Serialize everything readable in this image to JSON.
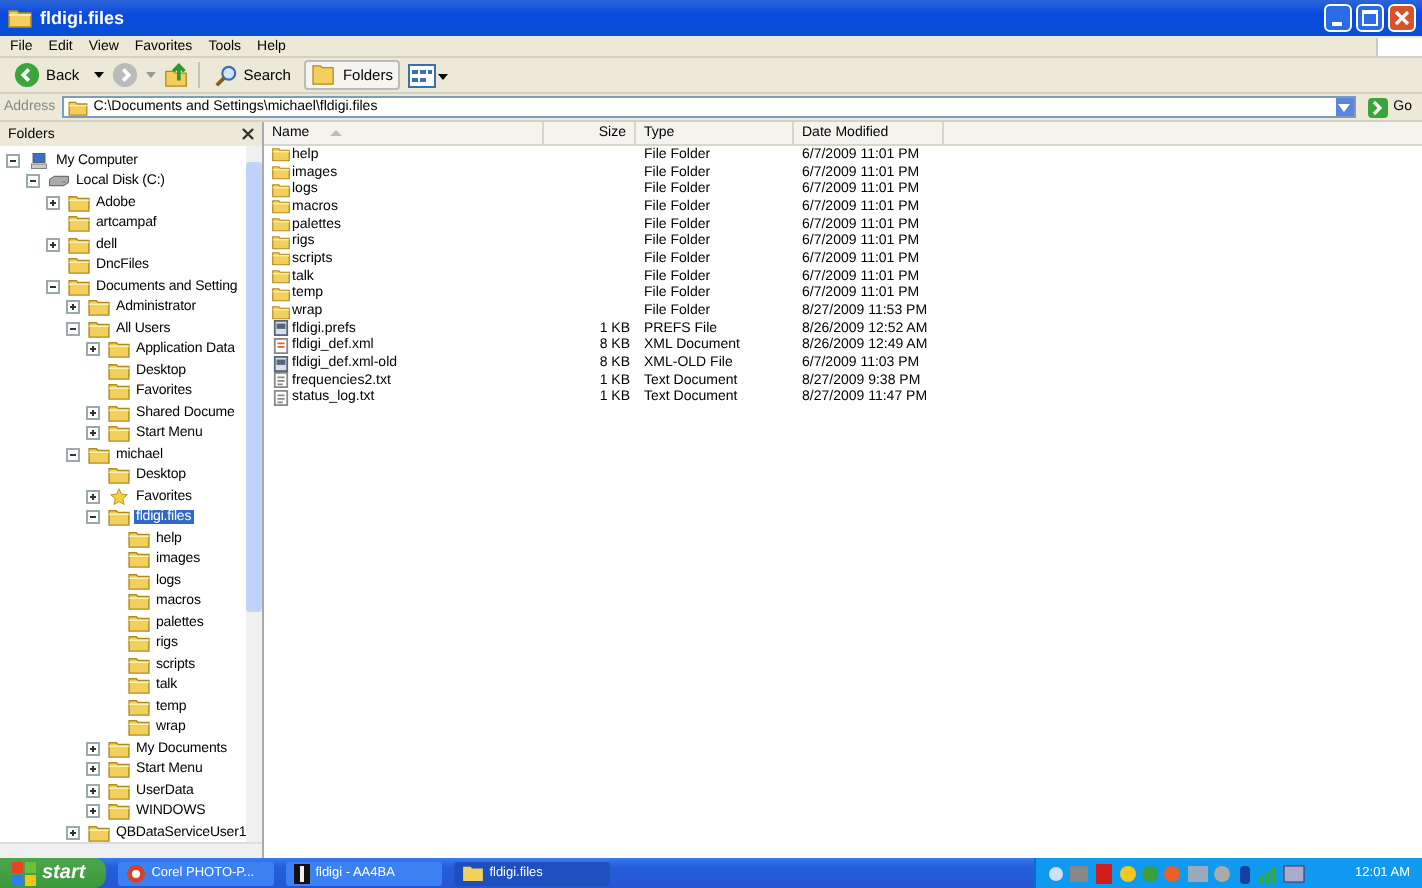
{
  "window": {
    "title": "fldigi.files"
  },
  "menu": [
    "File",
    "Edit",
    "View",
    "Favorites",
    "Tools",
    "Help"
  ],
  "toolbar": {
    "back": "Back",
    "search": "Search",
    "folders": "Folders"
  },
  "address": {
    "label": "Address",
    "value": "C:\\Documents and Settings\\michael\\fldigi.files",
    "go": "Go"
  },
  "folders_pane": {
    "title": "Folders"
  },
  "tree": {
    "items": [
      {
        "label": "My Computer",
        "kind": "computer",
        "has_children": true,
        "expanded": true,
        "selected": false,
        "children": [
          {
            "label": "Local Disk (C:)",
            "kind": "drive",
            "has_children": true,
            "expanded": true,
            "selected": false,
            "children": [
              {
                "label": "Adobe",
                "kind": "folder",
                "has_children": true,
                "expanded": false,
                "selected": false
              },
              {
                "label": "artcampaf",
                "kind": "folder",
                "has_children": false,
                "expanded": false,
                "selected": false
              },
              {
                "label": "dell",
                "kind": "folder",
                "has_children": true,
                "expanded": false,
                "selected": false
              },
              {
                "label": "DncFiles",
                "kind": "folder",
                "has_children": false,
                "expanded": false,
                "selected": false
              },
              {
                "label": "Documents and Setting",
                "kind": "folder",
                "has_children": true,
                "expanded": true,
                "selected": false,
                "children": [
                  {
                    "label": "Administrator",
                    "kind": "folder",
                    "has_children": true,
                    "expanded": false,
                    "selected": false
                  },
                  {
                    "label": "All Users",
                    "kind": "folder",
                    "has_children": true,
                    "expanded": true,
                    "selected": false,
                    "children": [
                      {
                        "label": "Application Data",
                        "kind": "folder",
                        "has_children": true,
                        "expanded": false,
                        "selected": false
                      },
                      {
                        "label": "Desktop",
                        "kind": "folder",
                        "has_children": false,
                        "expanded": false,
                        "selected": false
                      },
                      {
                        "label": "Favorites",
                        "kind": "folder",
                        "has_children": false,
                        "expanded": false,
                        "selected": false
                      },
                      {
                        "label": "Shared Docume",
                        "kind": "folder",
                        "has_children": true,
                        "expanded": false,
                        "selected": false
                      },
                      {
                        "label": "Start Menu",
                        "kind": "folder",
                        "has_children": true,
                        "expanded": false,
                        "selected": false
                      }
                    ]
                  },
                  {
                    "label": "michael",
                    "kind": "folder",
                    "has_children": true,
                    "expanded": true,
                    "selected": false,
                    "children": [
                      {
                        "label": "Desktop",
                        "kind": "folder",
                        "has_children": false,
                        "expanded": false,
                        "selected": false
                      },
                      {
                        "label": "Favorites",
                        "kind": "favorites",
                        "has_children": true,
                        "expanded": false,
                        "selected": false
                      },
                      {
                        "label": "fldigi.files",
                        "kind": "folder",
                        "has_children": true,
                        "expanded": true,
                        "selected": true,
                        "children": [
                          {
                            "label": "help",
                            "kind": "folder",
                            "has_children": false,
                            "expanded": false,
                            "selected": false
                          },
                          {
                            "label": "images",
                            "kind": "folder",
                            "has_children": false,
                            "expanded": false,
                            "selected": false
                          },
                          {
                            "label": "logs",
                            "kind": "folder",
                            "has_children": false,
                            "expanded": false,
                            "selected": false
                          },
                          {
                            "label": "macros",
                            "kind": "folder",
                            "has_children": false,
                            "expanded": false,
                            "selected": false
                          },
                          {
                            "label": "palettes",
                            "kind": "folder",
                            "has_children": false,
                            "expanded": false,
                            "selected": false
                          },
                          {
                            "label": "rigs",
                            "kind": "folder",
                            "has_children": false,
                            "expanded": false,
                            "selected": false
                          },
                          {
                            "label": "scripts",
                            "kind": "folder",
                            "has_children": false,
                            "expanded": false,
                            "selected": false
                          },
                          {
                            "label": "talk",
                            "kind": "folder",
                            "has_children": false,
                            "expanded": false,
                            "selected": false
                          },
                          {
                            "label": "temp",
                            "kind": "folder",
                            "has_children": false,
                            "expanded": false,
                            "selected": false
                          },
                          {
                            "label": "wrap",
                            "kind": "folder",
                            "has_children": false,
                            "expanded": false,
                            "selected": false
                          }
                        ]
                      },
                      {
                        "label": "My Documents",
                        "kind": "folder",
                        "has_children": true,
                        "expanded": false,
                        "selected": false
                      },
                      {
                        "label": "Start Menu",
                        "kind": "folder",
                        "has_children": true,
                        "expanded": false,
                        "selected": false
                      },
                      {
                        "label": "UserData",
                        "kind": "folder",
                        "has_children": true,
                        "expanded": false,
                        "selected": false
                      },
                      {
                        "label": "WINDOWS",
                        "kind": "folder",
                        "has_children": true,
                        "expanded": false,
                        "selected": false
                      }
                    ]
                  },
                  {
                    "label": "QBDataServiceUser1",
                    "kind": "folder",
                    "has_children": true,
                    "expanded": false,
                    "selected": false
                  }
                ]
              }
            ]
          }
        ]
      }
    ]
  },
  "list": {
    "columns": [
      "Name",
      "Size",
      "Type",
      "Date Modified"
    ],
    "rows": [
      {
        "name": "help",
        "kind": "folder",
        "type": "File Folder",
        "date": "6/7/2009 11:01 PM"
      },
      {
        "name": "images",
        "kind": "folder",
        "type": "File Folder",
        "date": "6/7/2009 11:01 PM"
      },
      {
        "name": "logs",
        "kind": "folder",
        "type": "File Folder",
        "date": "6/7/2009 11:01 PM"
      },
      {
        "name": "macros",
        "kind": "folder",
        "type": "File Folder",
        "date": "6/7/2009 11:01 PM"
      },
      {
        "name": "palettes",
        "kind": "folder",
        "type": "File Folder",
        "date": "6/7/2009 11:01 PM"
      },
      {
        "name": "rigs",
        "kind": "folder",
        "type": "File Folder",
        "date": "6/7/2009 11:01 PM"
      },
      {
        "name": "scripts",
        "kind": "folder",
        "type": "File Folder",
        "date": "6/7/2009 11:01 PM"
      },
      {
        "name": "talk",
        "kind": "folder",
        "type": "File Folder",
        "date": "6/7/2009 11:01 PM"
      },
      {
        "name": "temp",
        "kind": "folder",
        "type": "File Folder",
        "date": "6/7/2009 11:01 PM"
      },
      {
        "name": "wrap",
        "kind": "folder",
        "type": "File Folder",
        "date": "8/27/2009 11:53 PM"
      },
      {
        "name": "fldigi.prefs",
        "kind": "file",
        "size": "1 KB",
        "type": "PREFS File",
        "date": "8/26/2009 12:52 AM"
      },
      {
        "name": "fldigi_def.xml",
        "kind": "xml",
        "size": "8 KB",
        "type": "XML Document",
        "date": "8/26/2009 12:49 AM"
      },
      {
        "name": "fldigi_def.xml-old",
        "kind": "file",
        "size": "8 KB",
        "type": "XML-OLD File",
        "date": "6/7/2009 11:03 PM"
      },
      {
        "name": "frequencies2.txt",
        "kind": "text",
        "size": "1 KB",
        "type": "Text Document",
        "date": "8/27/2009 9:38 PM"
      },
      {
        "name": "status_log.txt",
        "kind": "text",
        "size": "1 KB",
        "type": "Text Document",
        "date": "8/27/2009 11:47 PM"
      }
    ]
  },
  "taskbar": {
    "start": "start",
    "tasks": [
      {
        "label": "Corel PHOTO-P...",
        "kind": "corel",
        "selected": false
      },
      {
        "label": "fldigi - AA4BA",
        "kind": "app",
        "selected": false
      },
      {
        "label": "fldigi.files",
        "kind": "folder",
        "selected": true
      }
    ],
    "clock": "12:01 AM"
  }
}
